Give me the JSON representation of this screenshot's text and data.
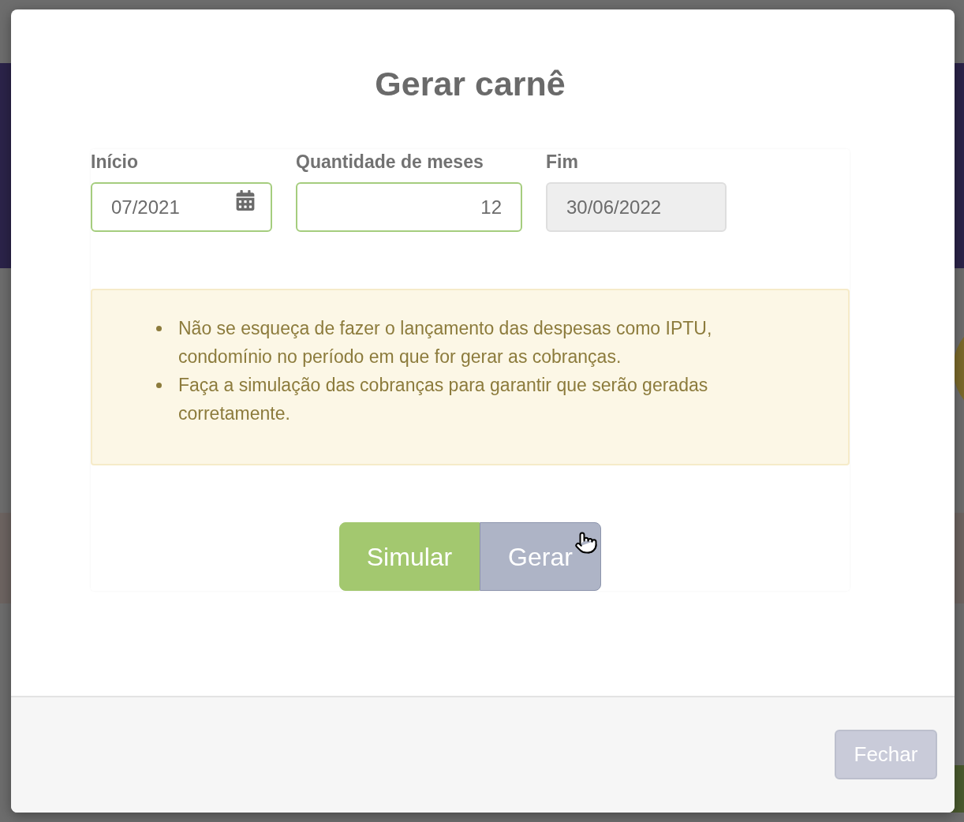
{
  "dialog": {
    "title": "Gerar carnê"
  },
  "form": {
    "fields": [
      {
        "label": "Início",
        "value": "07/2021",
        "kind": "date",
        "disabled": false
      },
      {
        "label": "Quantidade de meses",
        "value": "12",
        "kind": "number",
        "disabled": false
      },
      {
        "label": "Fim",
        "value": "30/06/2022",
        "kind": "text",
        "disabled": true
      }
    ]
  },
  "notice": {
    "items": [
      "Não se esqueça de fazer o lançamento das despesas como IPTU, condomínio no período em que for gerar as cobranças.",
      "Faça a simulação das cobranças para garantir que serão geradas corretamente."
    ]
  },
  "actions": [
    {
      "label": "Simular",
      "kind": "primary"
    },
    {
      "label": "Gerar",
      "kind": "secondary"
    }
  ],
  "footer": {
    "close_button": {
      "label": "Fechar"
    }
  }
}
